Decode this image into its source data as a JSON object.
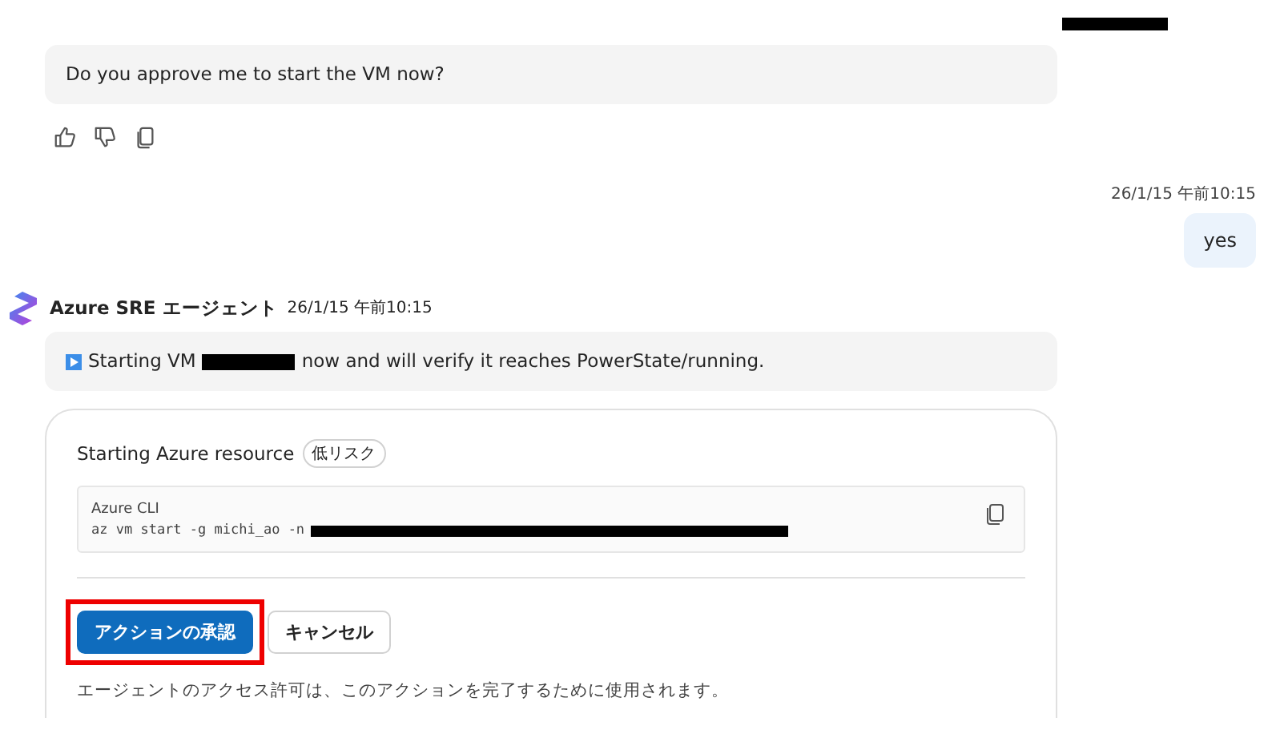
{
  "messages": [
    {
      "kind": "agent_text",
      "text": "Do you approve me to start the VM now?"
    },
    {
      "kind": "user",
      "time": "26/1/15 午前10:15",
      "text": "yes"
    },
    {
      "kind": "agent",
      "name": "Azure SRE エージェント",
      "time": "26/1/15 午前10:15",
      "status_before": "Starting VM",
      "status_after": "now and will verify it reaches PowerState/running.",
      "action": {
        "title": "Starting Azure resource",
        "risk": "低リスク",
        "code_label": "Azure CLI",
        "command": "az vm start -g michi_ao -n",
        "approve": "アクションの承認",
        "cancel": "キャンセル",
        "highlighted": true,
        "note": "エージェントのアクセス許可は、このアクションを完了するために使用されます。"
      }
    }
  ]
}
